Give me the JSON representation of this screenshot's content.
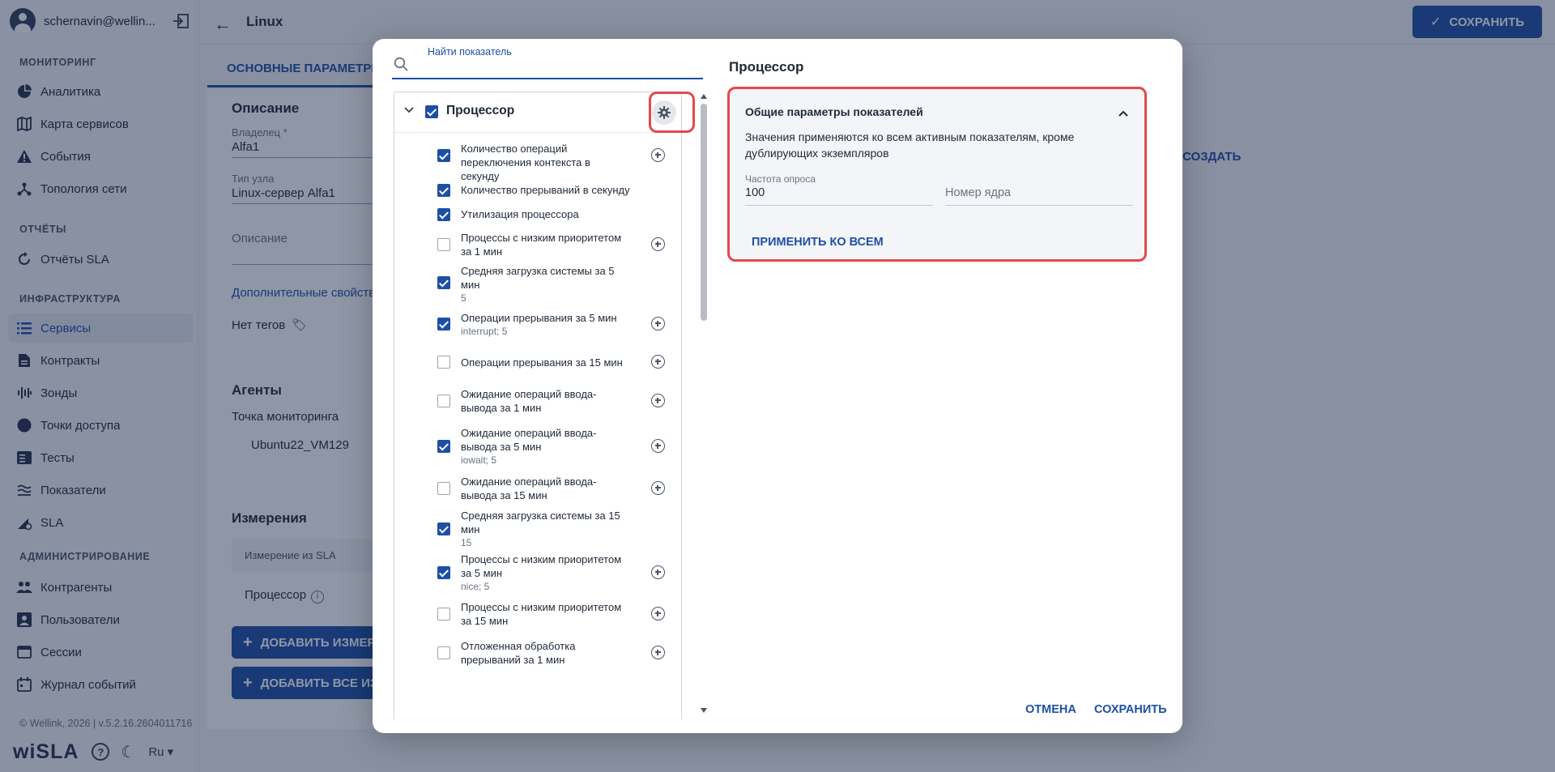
{
  "sidebar": {
    "user": "schernavin@wellin...",
    "sections": {
      "monitoring": "МОНИТОРИНГ",
      "reports": "ОТЧЁТЫ",
      "infrastructure": "ИНФРАСТРУКТУРА",
      "administration": "АДМИНИСТРИРОВАНИЕ"
    },
    "items": {
      "analytics": "Аналитика",
      "service_map": "Карта сервисов",
      "events": "События",
      "network_topology": "Топология сети",
      "sla_reports": "Отчёты SLA",
      "services": "Сервисы",
      "contracts": "Контракты",
      "probes": "Зонды",
      "access_points": "Точки доступа",
      "tests": "Тесты",
      "metrics": "Показатели",
      "sla": "SLA",
      "counterparties": "Контрагенты",
      "users": "Пользователи",
      "sessions": "Сессии",
      "event_log": "Журнал событий"
    },
    "footer": "© Wellink, 2026 | v.5.2.16.2604011716",
    "brand": "wiSLA",
    "lang": "Ru ▾"
  },
  "header": {
    "title": "Linux",
    "save_label": "СОХРАНИТЬ"
  },
  "main": {
    "tab_active": "ОСНОВНЫЕ ПАРАМЕТРЫ",
    "create_link": "СОЗДАТЬ",
    "description_heading": "Описание",
    "owner_label": "Владелец *",
    "owner_value": "Alfa1",
    "node_type_label": "Тип узла",
    "node_type_value": "Linux-сервер Alfa1",
    "description_placeholder": "Описание",
    "extra_props_link": "Дополнительные свойства",
    "no_tags": "Нет тегов",
    "agents_heading": "Агенты",
    "monitoring_point_label": "Точка мониторинга",
    "agent_value": "Ubuntu22_VM129",
    "measurements_heading": "Измерения",
    "table_header": "Измерение из SLA",
    "table_row": "Процессор",
    "add_measurement_btn": "ДОБАВИТЬ ИЗМЕРЕНИЕ",
    "add_all_btn": "ДОБАВИТЬ ВСЕ ИЗМЕРЕНИЯ"
  },
  "modal": {
    "search_label": "Найти показатель",
    "search_value": "",
    "tree_root": "Процессор",
    "metrics": [
      {
        "name": "Количество операций переключения контекста в секунду",
        "sub": "",
        "checked": true,
        "add": true
      },
      {
        "name": "Количество прерываний в секунду",
        "sub": "",
        "checked": true,
        "add": false
      },
      {
        "name": "Утилизация процессора",
        "sub": "",
        "checked": true,
        "add": false
      },
      {
        "name": "Процессы с низким приоритетом за 1 мин",
        "sub": "",
        "checked": false,
        "add": true
      },
      {
        "name": "Средняя загрузка системы за 5 мин",
        "sub": "5",
        "checked": true,
        "add": false
      },
      {
        "name": "Операции прерывания за 5 мин",
        "sub": "interrupt; 5",
        "checked": true,
        "add": true
      },
      {
        "name": "Операции прерывания за 15 мин",
        "sub": "",
        "checked": false,
        "add": true
      },
      {
        "name": "Ожидание операций ввода-вывода за 1 мин",
        "sub": "",
        "checked": false,
        "add": true
      },
      {
        "name": "Ожидание операций ввода-вывода за 5 мин",
        "sub": "iowait; 5",
        "checked": true,
        "add": true
      },
      {
        "name": "Ожидание операций ввода-вывода за 15 мин",
        "sub": "",
        "checked": false,
        "add": true
      },
      {
        "name": "Средняя загрузка системы за 15 мин",
        "sub": "15",
        "checked": true,
        "add": false
      },
      {
        "name": "Процессы с низким приоритетом за 5 мин",
        "sub": "nice; 5",
        "checked": true,
        "add": true
      },
      {
        "name": "Процессы с низким приоритетом за 15 мин",
        "sub": "",
        "checked": false,
        "add": true
      },
      {
        "name": "Отложенная обработка прерываний за 1 мин",
        "sub": "",
        "checked": false,
        "add": true
      }
    ],
    "right_title": "Процессор",
    "params_title": "Общие параметры показателей",
    "params_desc": "Значения применяются ко всем активным показателям, кроме дублирующих экземпляров",
    "poll_label": "Частота опроса",
    "poll_value": "100",
    "core_placeholder": "Номер ядра",
    "apply_all": "ПРИМЕНИТЬ КО ВСЕМ",
    "cancel": "ОТМЕНА",
    "save": "СОХРАНИТЬ"
  },
  "colors": {
    "accent": "#1e4fa6",
    "highlight": "#e5484d",
    "overlay": "rgba(20,36,70,0.48)"
  }
}
